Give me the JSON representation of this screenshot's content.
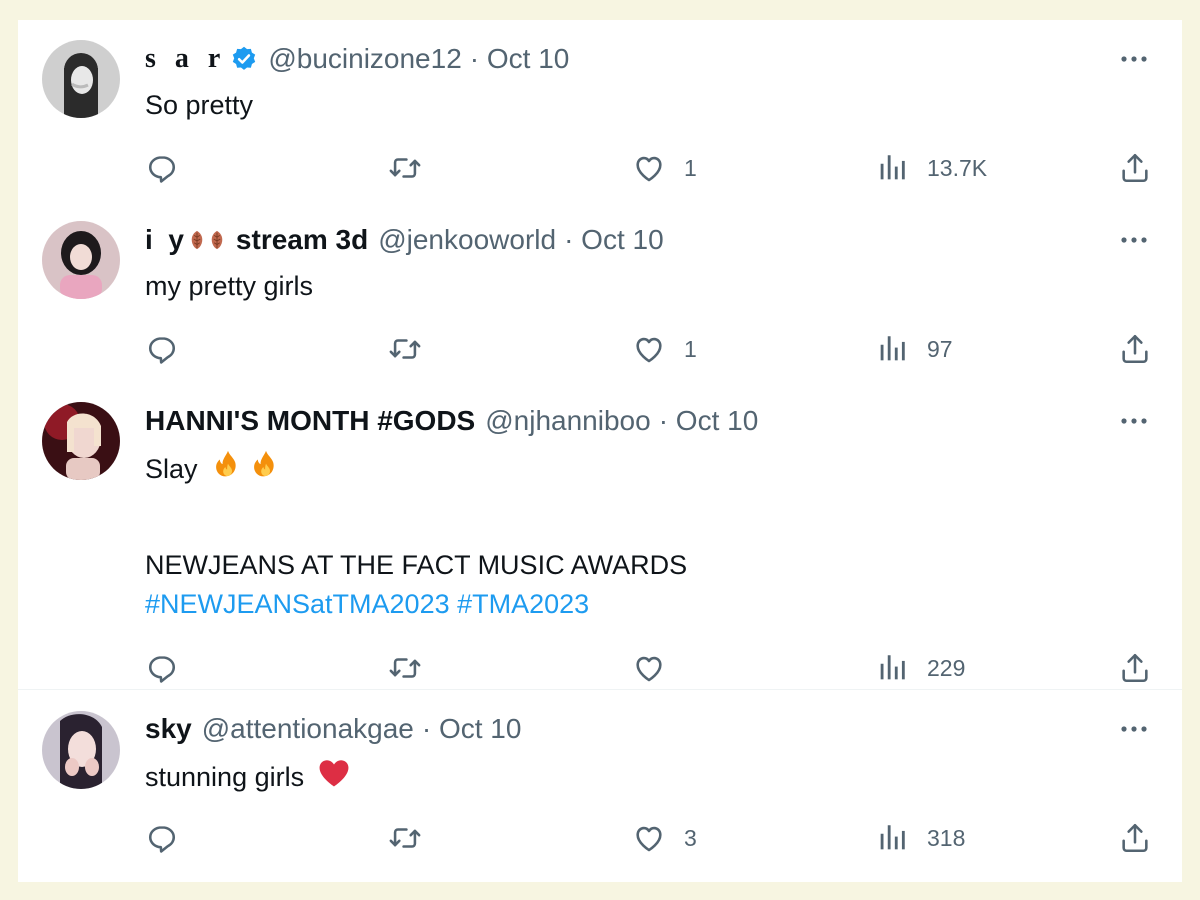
{
  "tweets": [
    {
      "name": "s a r",
      "handle": "@bucinizone12",
      "date": "· Oct 10",
      "verified": true,
      "text": "So pretty",
      "replies": "",
      "reposts": "",
      "likes": "1",
      "views": "13.7K"
    },
    {
      "name": "i  y",
      "name_suffix": "stream 3d",
      "handle": "@jenkooworld",
      "date": "· Oct 10",
      "text": "my pretty girls",
      "replies": "",
      "reposts": "",
      "likes": "1",
      "views": "97"
    },
    {
      "name": "HANNI'S MONTH #GODS",
      "handle": "@njhanniboo",
      "date": "· Oct 10",
      "text": "Slay",
      "text_line2": "NEWJEANS AT THE FACT MUSIC AWARDS",
      "hashtags": "#NEWJEANSatTMA2023 #TMA2023",
      "replies": "",
      "reposts": "",
      "likes": "",
      "views": "229"
    },
    {
      "name": "sky",
      "handle": "@attentionakgae",
      "date": "· Oct 10",
      "text": "stunning girls",
      "replies": "",
      "reposts": "",
      "likes": "3",
      "views": "318"
    }
  ],
  "icons": {
    "reply": "speech-bubble-icon",
    "repost": "repost-arrows-icon",
    "like": "heart-outline-icon",
    "views": "bar-chart-icon",
    "share": "share-upload-icon",
    "more": "more-dots-icon",
    "verified": "verified-badge-icon",
    "fire": "fire-emoji",
    "heart": "red-heart-emoji",
    "leaves": "leaf-emoji"
  },
  "colors": {
    "accent": "#1d9bf0",
    "muted": "#536471",
    "text": "#0f1419",
    "background": "#f7f5e1"
  }
}
